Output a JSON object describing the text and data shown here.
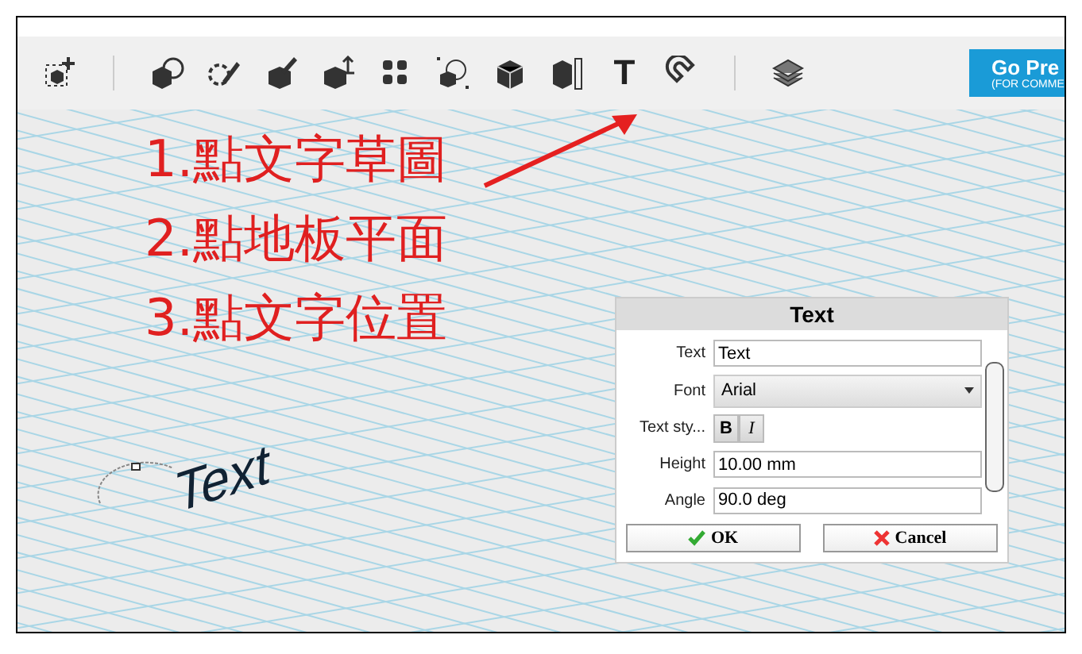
{
  "toolbar": {
    "tools": [
      {
        "kind": "add"
      },
      {
        "kind": "sep"
      },
      {
        "kind": "cube-sphere"
      },
      {
        "kind": "sketch"
      },
      {
        "kind": "brush"
      },
      {
        "kind": "move"
      },
      {
        "kind": "pattern"
      },
      {
        "kind": "group"
      },
      {
        "kind": "cube"
      },
      {
        "kind": "measure"
      },
      {
        "kind": "glyph",
        "glyph": "T"
      },
      {
        "kind": "snap"
      },
      {
        "kind": "sep"
      },
      {
        "kind": "layers"
      }
    ],
    "upgrade_button": {
      "label": "Go Pre",
      "sublabel": "(FOR COMME"
    }
  },
  "instructions": [
    "1.點文字草圖",
    "2.點地板平面",
    "3.點文字位置"
  ],
  "canvas_text": "Text",
  "dialog": {
    "title": "Text",
    "fields": [
      {
        "kind": "input",
        "label": "Text",
        "value": "Text"
      },
      {
        "kind": "select",
        "label": "Font",
        "value": "Arial"
      },
      {
        "kind": "style",
        "label": "Text sty...",
        "bold": "B",
        "italic": "I"
      },
      {
        "kind": "input",
        "label": "Height",
        "value": "10.00 mm"
      },
      {
        "kind": "input",
        "label": "Angle",
        "value": "90.0 deg"
      }
    ],
    "ok": "OK",
    "cancel": "Cancel"
  }
}
